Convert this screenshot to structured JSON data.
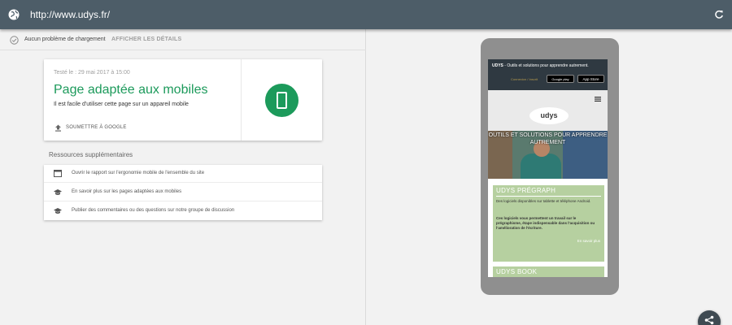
{
  "address_bar": {
    "url": "http://www.udys.fr/",
    "globe_icon": "globe-icon",
    "refresh_icon": "refresh-icon"
  },
  "status": {
    "text": "Aucun problème de chargement",
    "details_link": "AFFICHER LES DÉTAILS"
  },
  "result_card": {
    "tested": "Testé le : 29 mai 2017 à 15:00",
    "title": "Page adaptée aux mobiles",
    "subtitle": "Il est facile d'utiliser cette page sur un appareil mobile",
    "submit": "SOUMETTRE À GOOGLE",
    "accent_color": "#1c9a5b"
  },
  "resources": {
    "title": "Ressources supplémentaires",
    "items": [
      {
        "icon": "browser-window-icon",
        "text": "Ouvrir le rapport sur l'ergonomie mobile de l'ensemble du site"
      },
      {
        "icon": "graduation-cap-icon",
        "text": "En savoir plus sur les pages adaptées aux mobiles"
      },
      {
        "icon": "graduation-cap-icon",
        "text": "Publier des commentaires ou des questions sur notre groupe de discussion"
      }
    ]
  },
  "preview": {
    "brand": "UDYS",
    "tagline": " - Outils et solutions pour apprendre autrement.",
    "connect": "Connexion / Inscrit",
    "google_play": "Google play",
    "app_store": "App Store",
    "logo": "udys",
    "hero": "OUTILS ET SOLUTIONS POUR APPRENDRE AUTREMENT",
    "box1_title": "UDYS PRÉGRAPH",
    "box1_p1": "Des logiciels disponibles sur tablette et téléphone Android.",
    "box1_p2": "Ces logiciels vous permettent un travail sur le prégraphisme, étape indispensable dans l'acquisition ou l'amélioration de l'écriture.",
    "box1_more": "En savoir plus",
    "box2_title": "UDYS BOOK"
  }
}
